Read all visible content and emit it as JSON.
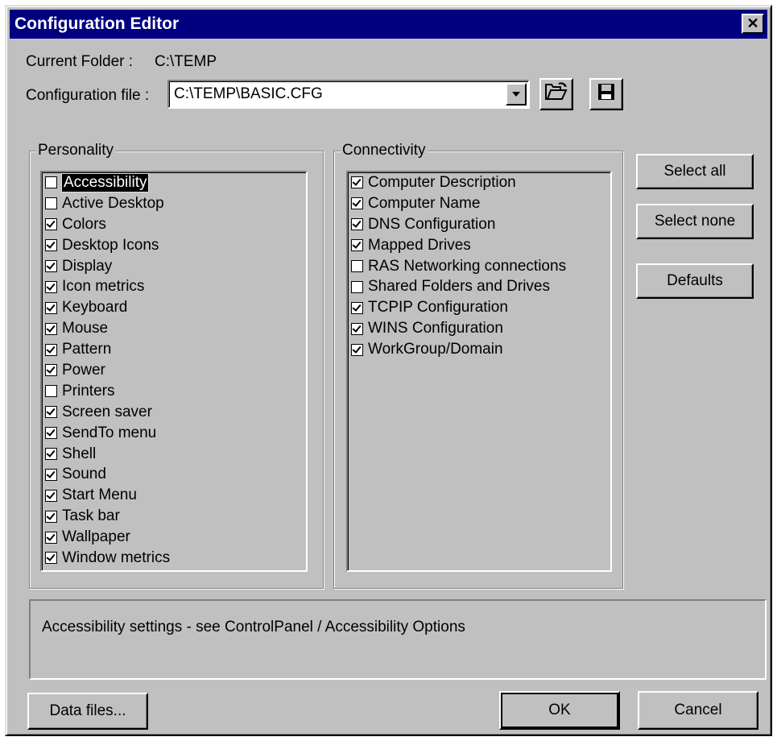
{
  "window": {
    "title": "Configuration Editor",
    "close_glyph": "✕"
  },
  "folder": {
    "label": "Current Folder :",
    "value": "C:\\TEMP"
  },
  "config_file": {
    "label": "Configuration file :",
    "value": "C:\\TEMP\\BASIC.CFG"
  },
  "personality": {
    "title": "Personality",
    "items": [
      {
        "label": "Accessibility",
        "checked": false,
        "selected": true
      },
      {
        "label": "Active Desktop",
        "checked": false
      },
      {
        "label": "Colors",
        "checked": true
      },
      {
        "label": "Desktop Icons",
        "checked": true
      },
      {
        "label": "Display",
        "checked": true
      },
      {
        "label": "Icon metrics",
        "checked": true
      },
      {
        "label": "Keyboard",
        "checked": true
      },
      {
        "label": "Mouse",
        "checked": true
      },
      {
        "label": "Pattern",
        "checked": true
      },
      {
        "label": "Power",
        "checked": true
      },
      {
        "label": "Printers",
        "checked": false
      },
      {
        "label": "Screen saver",
        "checked": true
      },
      {
        "label": "SendTo menu",
        "checked": true
      },
      {
        "label": "Shell",
        "checked": true
      },
      {
        "label": "Sound",
        "checked": true
      },
      {
        "label": "Start Menu",
        "checked": true
      },
      {
        "label": "Task bar",
        "checked": true
      },
      {
        "label": "Wallpaper",
        "checked": true
      },
      {
        "label": "Window metrics",
        "checked": true
      }
    ]
  },
  "connectivity": {
    "title": "Connectivity",
    "items": [
      {
        "label": "Computer Description",
        "checked": true
      },
      {
        "label": "Computer Name",
        "checked": true
      },
      {
        "label": "DNS Configuration",
        "checked": true
      },
      {
        "label": "Mapped Drives",
        "checked": true
      },
      {
        "label": "RAS Networking connections",
        "checked": false
      },
      {
        "label": "Shared Folders and Drives",
        "checked": false
      },
      {
        "label": "TCPIP Configuration",
        "checked": true
      },
      {
        "label": "WINS Configuration",
        "checked": true
      },
      {
        "label": "WorkGroup/Domain",
        "checked": true
      }
    ]
  },
  "buttons": {
    "select_all": "Select all",
    "select_none": "Select none",
    "defaults": "Defaults",
    "data_files": "Data files...",
    "ok": "OK",
    "cancel": "Cancel"
  },
  "description": "Accessibility settings - see ControlPanel / Accessibility Options",
  "icons": {
    "open": "open-folder-icon",
    "save": "floppy-disk-icon",
    "dropdown": "dropdown-arrow-icon"
  }
}
